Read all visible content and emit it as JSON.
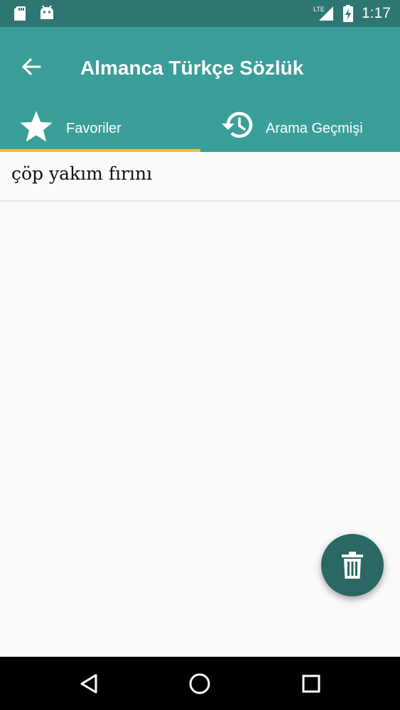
{
  "status_bar": {
    "time": "1:17",
    "network": "LTE",
    "icons": [
      "sd-card-icon",
      "android-icon",
      "signal-icon",
      "battery-charging-icon"
    ]
  },
  "app_bar": {
    "title": "Almanca Türkçe Sözlük",
    "back_icon": "arrow-back-icon"
  },
  "tabs": [
    {
      "label": "Favoriler",
      "icon": "star-icon",
      "selected": true
    },
    {
      "label": "Arama Geçmişi",
      "icon": "history-icon",
      "selected": false
    }
  ],
  "favorites": [
    {
      "text": "çöp yakım fırını"
    }
  ],
  "fab": {
    "icon": "trash-icon"
  },
  "nav_bar": {
    "icons": [
      "back-triangle-icon",
      "home-circle-icon",
      "recents-square-icon"
    ]
  },
  "colors": {
    "status_bar": "#2e7672",
    "app_bar": "#3a9e99",
    "tab_indicator": "#f2c230",
    "fab": "#2b6763"
  }
}
